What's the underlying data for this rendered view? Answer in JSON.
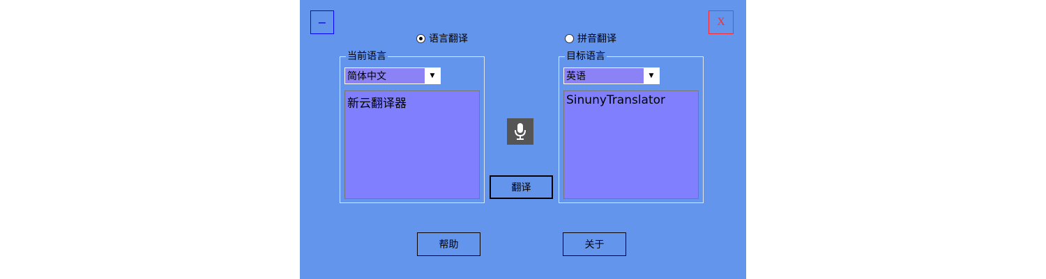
{
  "window": {
    "minimize_label": "−",
    "close_label": "X"
  },
  "mode": {
    "language_label": "语言翻译",
    "pinyin_label": "拼音翻译",
    "selected": "language"
  },
  "source": {
    "group_label": "当前语言",
    "language": "简体中文",
    "text": "新云翻译器"
  },
  "target": {
    "group_label": "目标语言",
    "language": "英语",
    "text": "SinunyTranslator"
  },
  "actions": {
    "mic_icon": "microphone-icon",
    "translate_label": "翻译",
    "help_label": "帮助",
    "about_label": "关于"
  },
  "colors": {
    "window_bg": "#6495ed",
    "textbox_bg": "#8080ff",
    "select_bg": "#8a82f5",
    "mic_bg": "#555555",
    "close_accent": "#ff2a2a",
    "minimize_accent": "#0000ff"
  }
}
